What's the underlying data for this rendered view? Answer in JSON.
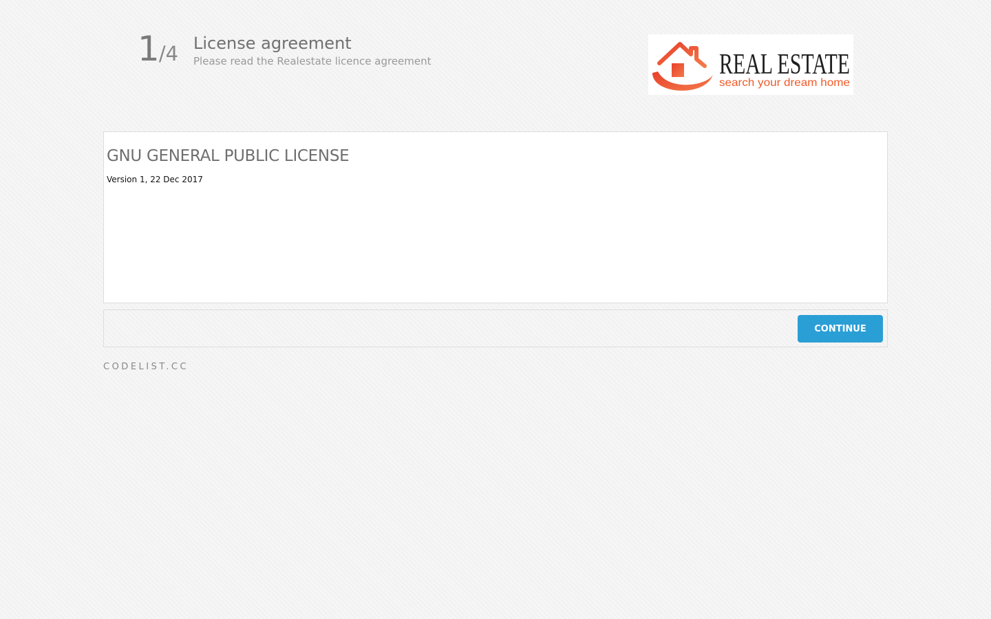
{
  "header": {
    "step_current": "1",
    "step_total": "/4",
    "title": "License agreement",
    "subtitle": "Please read the Realestate licence agreement"
  },
  "logo": {
    "text_line1": "REAL ESTATE",
    "text_line2": "search your dream home",
    "icon": "house-icon",
    "colors": {
      "brand_orange": "#f05a28",
      "brand_dark": "#1f1f1f"
    }
  },
  "license": {
    "title": "GNU GENERAL PUBLIC LICENSE",
    "version": "Version 1, 22 Dec 2017"
  },
  "actions": {
    "continue_label": "CONTINUE",
    "accent_color": "#2a9fd6"
  },
  "footer": {
    "text": "CODELIST.CC"
  }
}
